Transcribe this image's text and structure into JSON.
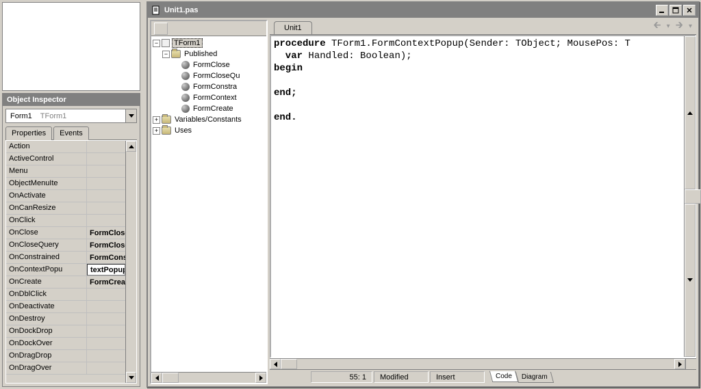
{
  "object_inspector": {
    "title": "Object Inspector",
    "combo": {
      "name": "Form1",
      "type": "TForm1"
    },
    "tabs": {
      "properties": "Properties",
      "events": "Events"
    },
    "rows": [
      {
        "name": "Action",
        "value": ""
      },
      {
        "name": "ActiveControl",
        "value": ""
      },
      {
        "name": "Menu",
        "value": ""
      },
      {
        "name": "ObjectMenuIte",
        "value": ""
      },
      {
        "name": "OnActivate",
        "value": ""
      },
      {
        "name": "OnCanResize",
        "value": ""
      },
      {
        "name": "OnClick",
        "value": ""
      },
      {
        "name": "OnClose",
        "value": "FormClose"
      },
      {
        "name": "OnCloseQuery",
        "value": "FormCloseQue"
      },
      {
        "name": "OnConstrained",
        "value": "FormConstrai"
      },
      {
        "name": "OnContextPopu",
        "value": "textPopup",
        "editing": true
      },
      {
        "name": "OnCreate",
        "value": "FormCreate"
      },
      {
        "name": "OnDblClick",
        "value": ""
      },
      {
        "name": "OnDeactivate",
        "value": ""
      },
      {
        "name": "OnDestroy",
        "value": ""
      },
      {
        "name": "OnDockDrop",
        "value": ""
      },
      {
        "name": "OnDockOver",
        "value": ""
      },
      {
        "name": "OnDragDrop",
        "value": ""
      },
      {
        "name": "OnDragOver",
        "value": ""
      }
    ]
  },
  "window": {
    "title": "Unit1.pas",
    "tree": {
      "root": "TForm1",
      "published": "Published",
      "methods": [
        "FormClose",
        "FormCloseQu",
        "FormConstra",
        "FormContext",
        "FormCreate"
      ],
      "vars": "Variables/Constants",
      "uses": "Uses"
    },
    "file_tab": "Unit1",
    "code": {
      "l1a": "procedure",
      "l1b": " TForm1.FormContextPopup(Sender: TObject; MousePos: T",
      "l2a": "  var",
      "l2b": " Handled: Boolean);",
      "l3": "begin",
      "l5": "end;",
      "l7": "end."
    },
    "status": {
      "pos": "55: 1",
      "modified": "Modified",
      "insert": "Insert",
      "code_tab": "Code",
      "diagram_tab": "Diagram"
    }
  }
}
